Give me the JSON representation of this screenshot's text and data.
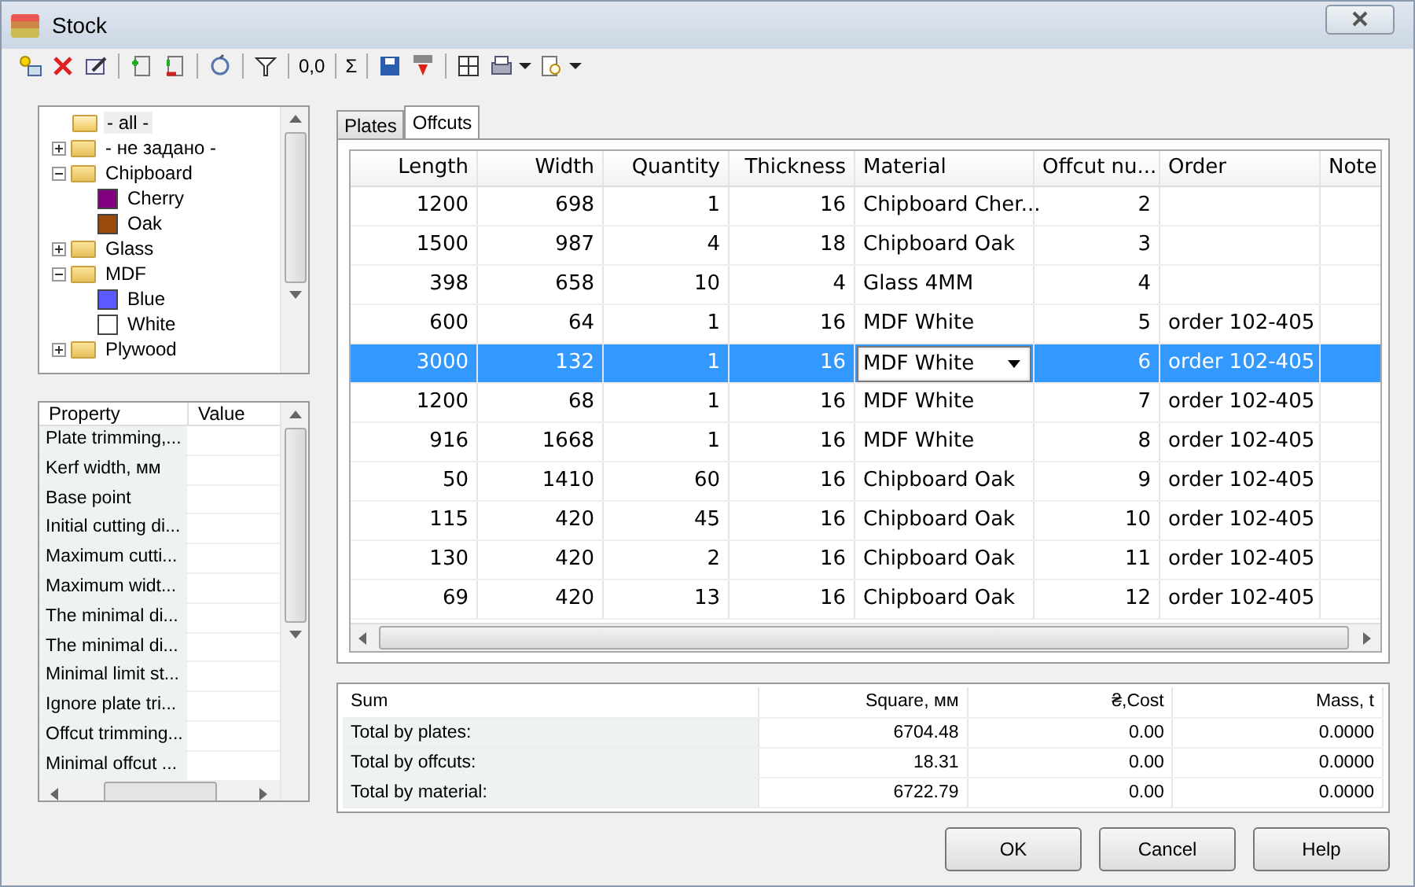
{
  "window": {
    "title": "Stock"
  },
  "toolbar": [
    {
      "kind": "add"
    },
    {
      "kind": "delete"
    },
    {
      "kind": "edit"
    },
    {
      "kind": "sep"
    },
    {
      "kind": "import"
    },
    {
      "kind": "export"
    },
    {
      "kind": "sep"
    },
    {
      "kind": "refresh"
    },
    {
      "kind": "sep"
    },
    {
      "kind": "filter"
    },
    {
      "kind": "sep"
    },
    {
      "kind": "text",
      "label": "0,0"
    },
    {
      "kind": "sep"
    },
    {
      "kind": "text",
      "label": "Σ"
    },
    {
      "kind": "sep"
    },
    {
      "kind": "save"
    },
    {
      "kind": "download"
    },
    {
      "kind": "sep"
    },
    {
      "kind": "grid"
    },
    {
      "kind": "print",
      "dropdown": true
    },
    {
      "kind": "preview",
      "dropdown": true
    }
  ],
  "tree": [
    {
      "label": "- all -",
      "selected": true
    },
    {
      "label": "- не задано -",
      "expanded": false,
      "selected": false
    },
    {
      "label": "Chipboard",
      "expanded": true,
      "selected": false,
      "children": [
        {
          "label": "Cherry",
          "color": "#800080",
          "selected": false
        },
        {
          "label": "Oak",
          "color": "#9a4a0a",
          "selected": false
        }
      ]
    },
    {
      "label": "Glass",
      "expanded": false,
      "selected": false
    },
    {
      "label": "MDF",
      "expanded": true,
      "selected": false,
      "children": [
        {
          "label": "Blue",
          "color": "#5a5aff",
          "selected": false
        },
        {
          "label": "White",
          "color": "#ffffff",
          "selected": false
        }
      ]
    },
    {
      "label": "Plywood",
      "expanded": false,
      "selected": false
    }
  ],
  "properties": {
    "columns": [
      "Property",
      "Value"
    ],
    "rows": [
      "Plate trimming,...",
      "Kerf width, мм",
      "Base point",
      "Initial cutting di...",
      "Maximum cutti...",
      "Maximum widt...",
      "The minimal di...",
      "The minimal di...",
      "Minimal limit st...",
      "Ignore plate tri...",
      "Offcut trimming...",
      "Minimal offcut ..."
    ]
  },
  "tabs": [
    {
      "label": "Plates",
      "selected": false
    },
    {
      "label": "Offcuts",
      "selected": true
    }
  ],
  "table": {
    "columns": [
      "Length",
      "Width",
      "Quantity",
      "Thickness",
      "Material",
      "Offcut nu...",
      "Order",
      "Note"
    ],
    "rows": [
      {
        "cells": [
          "1200",
          "698",
          "1",
          "16",
          "Chipboard Cher...",
          "2",
          ""
        ],
        "selected": false
      },
      {
        "cells": [
          "1500",
          "987",
          "4",
          "18",
          "Chipboard Oak",
          "3",
          ""
        ],
        "selected": false
      },
      {
        "cells": [
          "398",
          "658",
          "10",
          "4",
          "Glass 4MM",
          "4",
          ""
        ],
        "selected": false
      },
      {
        "cells": [
          "600",
          "64",
          "1",
          "16",
          "MDF White",
          "5",
          "order 102-405"
        ],
        "selected": false
      },
      {
        "cells": [
          "3000",
          "132",
          "1",
          "16",
          "MDF White",
          "6",
          "order 102-405"
        ],
        "selected": true,
        "editing": true
      },
      {
        "cells": [
          "1200",
          "68",
          "1",
          "16",
          "MDF White",
          "7",
          "order 102-405"
        ],
        "selected": false
      },
      {
        "cells": [
          "916",
          "1668",
          "1",
          "16",
          "MDF White",
          "8",
          "order 102-405"
        ],
        "selected": false
      },
      {
        "cells": [
          "50",
          "1410",
          "60",
          "16",
          "Chipboard Oak",
          "9",
          "order 102-405"
        ],
        "selected": false
      },
      {
        "cells": [
          "115",
          "420",
          "45",
          "16",
          "Chipboard Oak",
          "10",
          "order 102-405"
        ],
        "selected": false
      },
      {
        "cells": [
          "130",
          "420",
          "2",
          "16",
          "Chipboard Oak",
          "11",
          "order 102-405"
        ],
        "selected": false
      },
      {
        "cells": [
          "69",
          "420",
          "13",
          "16",
          "Chipboard Oak",
          "12",
          "order 102-405"
        ],
        "selected": false
      }
    ]
  },
  "summary": {
    "columns": [
      "Sum",
      "Square, мм",
      "₴,Cost",
      "Mass, t"
    ],
    "rows": [
      [
        "Total by plates:",
        "6704.48",
        "0.00",
        "0.0000"
      ],
      [
        "Total by offcuts:",
        "18.31",
        "0.00",
        "0.0000"
      ],
      [
        "Total by material:",
        "6722.79",
        "0.00",
        "0.0000"
      ]
    ]
  },
  "buttons": [
    "OK",
    "Cancel",
    "Help"
  ]
}
